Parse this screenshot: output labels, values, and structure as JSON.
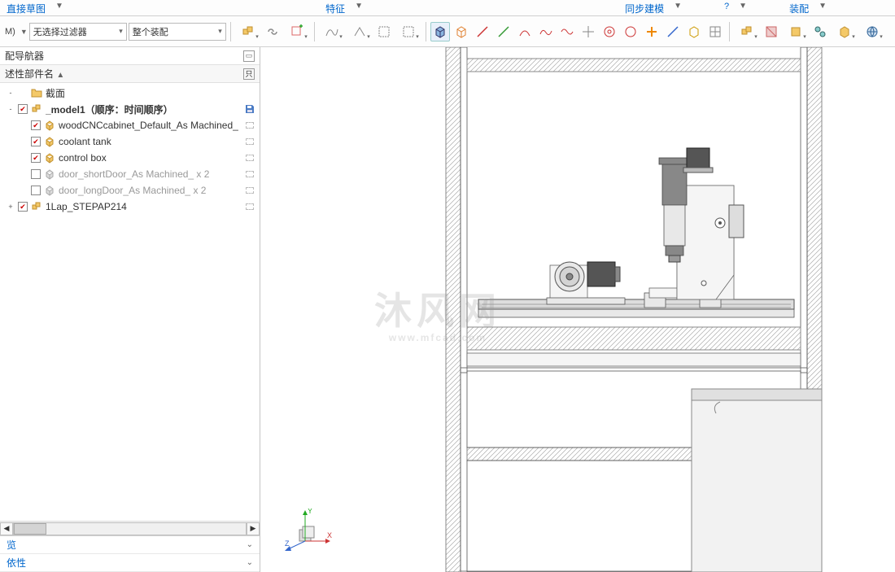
{
  "ribbon": {
    "tabs": [
      "直接草图",
      "特征",
      "同步建模",
      "?",
      "装配"
    ]
  },
  "toolbar": {
    "left_label": "M)",
    "filter_combo": "无选择过滤器",
    "assembly_combo": "整个装配"
  },
  "panel": {
    "title": "配导航器",
    "header": "述性部件名",
    "bottom_tabs": [
      "览",
      "依性"
    ]
  },
  "tree": {
    "nodes": [
      {
        "indent": 0,
        "expander": "-",
        "chk": false,
        "icon": "folder",
        "label": "截面",
        "bold": false,
        "grey": false,
        "end": "none"
      },
      {
        "indent": 0,
        "expander": "-",
        "chk": true,
        "icon": "asm",
        "label": "_model1（顺序：时间顺序）",
        "bold": true,
        "grey": false,
        "end": "save"
      },
      {
        "indent": 1,
        "expander": "",
        "chk": true,
        "icon": "cube",
        "label": "woodCNCcabinet_Default_As Machined_",
        "bold": false,
        "grey": false,
        "end": "box"
      },
      {
        "indent": 1,
        "expander": "",
        "chk": true,
        "icon": "cube",
        "label": "coolant tank",
        "bold": false,
        "grey": false,
        "end": "box"
      },
      {
        "indent": 1,
        "expander": "",
        "chk": true,
        "icon": "cube",
        "label": "control box",
        "bold": false,
        "grey": false,
        "end": "box"
      },
      {
        "indent": 1,
        "expander": "",
        "chk": false,
        "icon": "cube-grey",
        "label": "door_shortDoor_As Machined_ x 2",
        "bold": false,
        "grey": true,
        "end": "box"
      },
      {
        "indent": 1,
        "expander": "",
        "chk": false,
        "icon": "cube-grey",
        "label": "door_longDoor_As Machined_ x 2",
        "bold": false,
        "grey": true,
        "end": "box"
      },
      {
        "indent": 0,
        "expander": "+",
        "chk": true,
        "icon": "asm",
        "label": "1Lap_STEPAP214",
        "bold": false,
        "grey": false,
        "end": "box"
      }
    ]
  },
  "triad": {
    "x": "X",
    "y": "Y",
    "z": "Z"
  },
  "watermark": {
    "main": "沐风网",
    "sub": "www.mfcad.com"
  }
}
